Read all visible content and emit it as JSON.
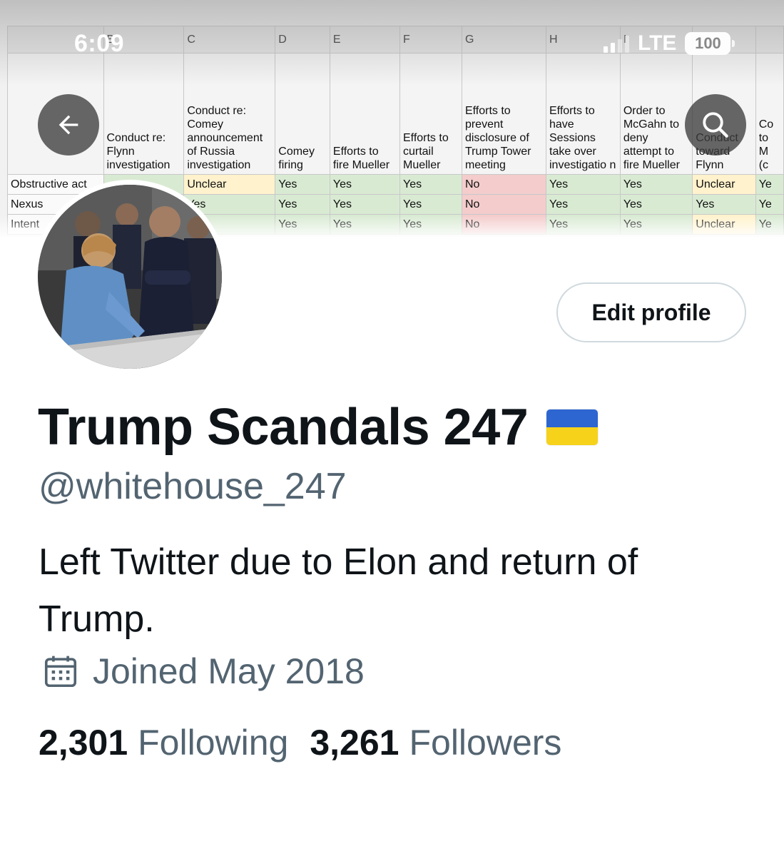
{
  "status_bar": {
    "time": "6:09",
    "network": "LTE",
    "battery": "100"
  },
  "banner": {
    "column_letters": [
      "",
      "B",
      "C",
      "D",
      "E",
      "F",
      "G",
      "H",
      "I",
      "",
      ""
    ],
    "headers": [
      "",
      "Conduct re: Flynn investigation",
      "Conduct re: Comey announcement of Russia investigation",
      "Comey firing",
      "Efforts to fire Mueller",
      "Efforts to curtail Mueller",
      "Efforts to prevent disclosure of Trump Tower meeting",
      "Efforts to have Sessions take over investigatio n",
      "Order to McGahn to deny attempt to fire Mueller",
      "Conduct toward Flynn",
      "Co to M (c"
    ],
    "rows": [
      {
        "label": "Obstructive act",
        "cells": [
          "",
          "Unclear",
          "Yes",
          "Yes",
          "Yes",
          "No",
          "Yes",
          "Yes",
          "Unclear",
          "Ye"
        ]
      },
      {
        "label": "Nexus",
        "cells": [
          "",
          "Yes",
          "Yes",
          "Yes",
          "Yes",
          "No",
          "Yes",
          "Yes",
          "Yes",
          "Ye"
        ]
      },
      {
        "label": "Intent",
        "cells": [
          "",
          "",
          "Yes",
          "Yes",
          "Yes",
          "No",
          "Yes",
          "Yes",
          "Unclear",
          "Ye"
        ]
      }
    ]
  },
  "buttons": {
    "back_icon": "arrow-left-icon",
    "search_icon": "search-icon",
    "edit_profile": "Edit profile"
  },
  "profile": {
    "display_name": "Trump Scandals 247",
    "flag": "ukraine-flag",
    "handle": "@whitehouse_247",
    "bio": "Left Twitter due to Elon and return of Trump.",
    "joined": "Joined May 2018",
    "following_count": "2,301",
    "following_label": "Following",
    "followers_count": "3,261",
    "followers_label": "Followers"
  },
  "colors": {
    "text_primary": "#0f1419",
    "text_secondary": "#536471",
    "border": "#cfd9de",
    "cell_yes": "#d9ead3",
    "cell_no": "#f4cccc",
    "cell_unclear": "#fff2cc"
  }
}
